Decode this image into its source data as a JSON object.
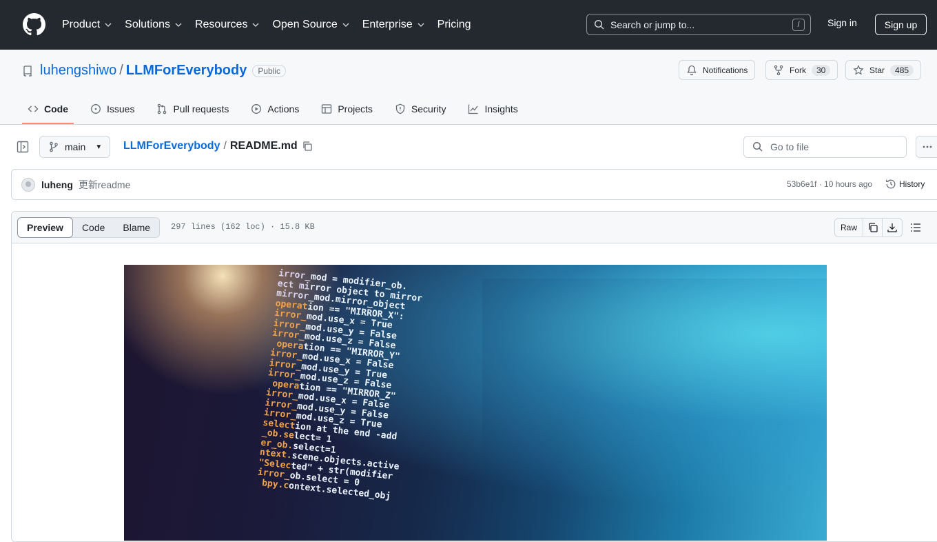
{
  "header": {
    "nav": [
      {
        "label": "Product",
        "dropdown": true
      },
      {
        "label": "Solutions",
        "dropdown": true
      },
      {
        "label": "Resources",
        "dropdown": true
      },
      {
        "label": "Open Source",
        "dropdown": true
      },
      {
        "label": "Enterprise",
        "dropdown": true
      },
      {
        "label": "Pricing",
        "dropdown": false
      }
    ],
    "search_placeholder": "Search or jump to...",
    "search_shortcut": "/",
    "sign_in": "Sign in",
    "sign_up": "Sign up"
  },
  "repo": {
    "owner": "luhengshiwo",
    "separator": "/",
    "name": "LLMForEverybody",
    "visibility": "Public",
    "notifications_label": "Notifications",
    "fork_label": "Fork",
    "fork_count": "30",
    "star_label": "Star",
    "star_count": "485",
    "tabs": [
      "Code",
      "Issues",
      "Pull requests",
      "Actions",
      "Projects",
      "Security",
      "Insights"
    ]
  },
  "file_nav": {
    "branch": "main",
    "repo_link": "LLMForEverybody",
    "separator": "/",
    "file_name": "README.md",
    "goto_placeholder": "Go to file"
  },
  "commit": {
    "author": "luheng",
    "message": "更新readme",
    "meta": "53b6e1f · 10 hours ago",
    "history_label": "History"
  },
  "file_view": {
    "modes": [
      "Preview",
      "Code",
      "Blame"
    ],
    "active_mode": "Preview",
    "info": "297 lines (162 loc) · 15.8 KB",
    "raw_label": "Raw"
  },
  "hero_code": [
    "irror_mod = modifier_ob.",
    "ect mirror object to mirror",
    "mirror_mod.mirror_object",
    "",
    "operation == \"MIRROR_X\":",
    "irror_mod.use_x = True",
    "irror_mod.use_y = False",
    "irror_mod.use_z = False",
    " operation == \"MIRROR_Y\"",
    "irror_mod.use_x = False",
    "irror_mod.use_y = True",
    "irror_mod.use_z = False",
    " operation == \"MIRROR_Z\"",
    "irror_mod.use_x = False",
    "irror_mod.use_y = False",
    "irror_mod.use_z = True",
    "",
    "selection at the end -add",
    "_ob.select= 1",
    "er_ob.select=1",
    "ntext.scene.objects.active",
    "\"Selected\" + str(modifier",
    "irror_ob.select = 0",
    " bpy.context.selected_obj"
  ],
  "colors": {
    "header_bg": "#24292f",
    "link": "#0969da",
    "tab_underline": "#fd8c73"
  }
}
